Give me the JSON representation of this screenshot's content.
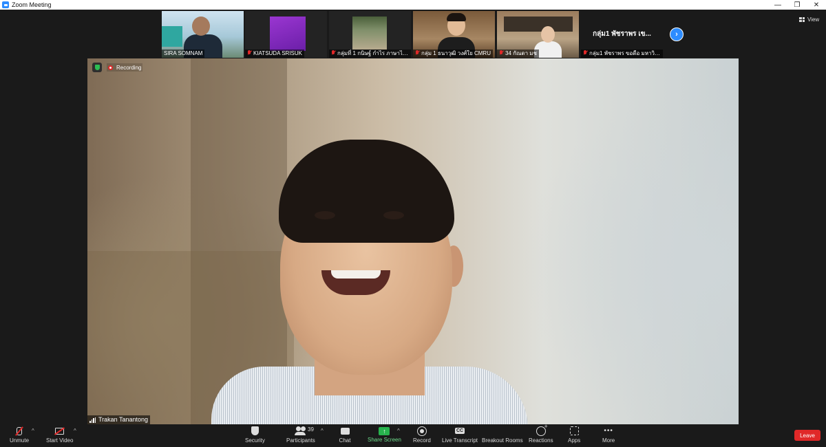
{
  "window": {
    "title": "Zoom Meeting",
    "controls": [
      "—",
      "❐",
      "✕"
    ]
  },
  "gallery": {
    "view_label": "View",
    "tiles": [
      {
        "name": "SIRA SOMNAM",
        "muted": false
      },
      {
        "name": "KIATSUDA SRISUK",
        "muted": true
      },
      {
        "name": "กลุ่มที่ 1 กนิษฐ์ กำไร ภาษาไทย ...",
        "muted": true
      },
      {
        "name": "กลุ่ม 1 ธนาวุฒิ วงศ์ใย CMRU",
        "muted": true
      },
      {
        "name": "34 กัณดา มช",
        "muted": true
      },
      {
        "name": "กลุ่ม1 พัชราพร ขอดือ มหาวิทย...",
        "muted": true,
        "caption": "กลุ่ม1 พัชราพร เข..."
      }
    ]
  },
  "main_video": {
    "speaker_name": "Trakan Tanantong",
    "recording_label": "Recording"
  },
  "toolbar": {
    "unmute": "Unmute",
    "start_video": "Start Video",
    "security": "Security",
    "participants": "Participants",
    "participants_count": "39",
    "chat": "Chat",
    "share_screen": "Share Screen",
    "record": "Record",
    "live_transcript": "Live Transcript",
    "breakout_rooms": "Breakout Rooms",
    "reactions": "Reactions",
    "apps": "Apps",
    "more": "More",
    "leave": "Leave",
    "caret": "^"
  },
  "colors": {
    "accent_blue": "#2d8cff",
    "share_green": "#27b34d",
    "leave_red": "#e02828",
    "mute_red": "#e02828"
  }
}
